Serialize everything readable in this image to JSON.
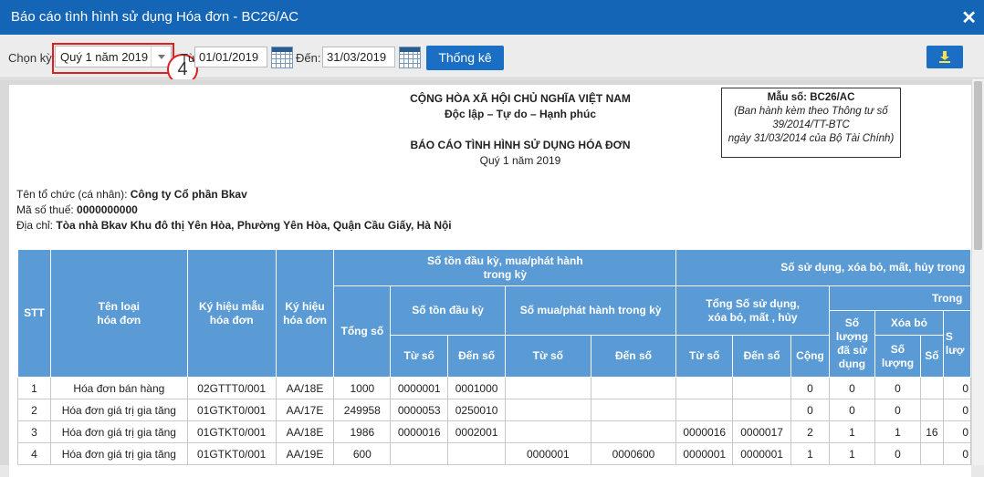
{
  "window": {
    "title": "Báo cáo tình hình sử dụng Hóa đơn - BC26/AC",
    "close_glyph": "✕"
  },
  "toolbar": {
    "period_label": "Chọn kỳ:",
    "period_value": "Quý 1 năm 2019",
    "from_label": "Từ:",
    "from_value": "01/01/2019",
    "to_label": "Đến:",
    "to_value": "31/03/2019",
    "stat_button": "Thống kê",
    "step_badge": "4"
  },
  "report": {
    "nation": "CỘNG HÒA XÃ HỘI CHỦ NGHĨA VIỆT NAM",
    "motto": "Độc lập – Tự do – Hạnh phúc",
    "title": "BÁO CÁO TÌNH HÌNH SỬ DỤNG HÓA ĐƠN",
    "period": "Quý 1 năm 2019",
    "form": {
      "code": "Mẫu số: BC26/AC",
      "line1": "(Ban hành kèm theo Thông tư số",
      "line2": "39/2014/TT-BTC",
      "line3": "ngày 31/03/2014 của Bộ Tài Chính)"
    },
    "org_label": "Tên tổ chức (cá nhân): ",
    "org_value": "Công ty Cổ phần Bkav",
    "tax_label": "Mã số thuế: ",
    "tax_value": "0000000000",
    "addr_label": "Địa chỉ: ",
    "addr_value": "Tòa nhà Bkav Khu đô thị Yên Hòa, Phường Yên Hòa, Quận Cầu Giấy, Hà Nội"
  },
  "table": {
    "h_stt": "STT",
    "h_type": "Tên loại\nhóa đơn",
    "h_template": "Ký hiệu mẫu\nhóa đơn",
    "h_symbol": "Ký hiệu\nhóa đơn",
    "h_opening_group": "Số tồn đầu kỳ, mua/phát hành\ntrong kỳ",
    "h_total": "Tổng số",
    "h_opening": "Số tồn đầu kỳ",
    "h_bought": "Số mua/phát hành trong kỳ",
    "h_from": "Từ số",
    "h_to": "Đến số",
    "h_usage_group": "Số sử dụng, xóa bỏ, mất, hủy trong",
    "h_usage_total": "Tổng Số sử dụng,\nxóa bỏ, mất , hủy",
    "h_sum": "Cộng",
    "h_within": "Trong",
    "h_used_qty": "Số\nlượng\nđã sử\ndụng",
    "h_cancel": "Xóa bỏ",
    "h_qty": "Số\nlượng",
    "h_num": "Số",
    "h_trunc": "S\nlượ",
    "rows": [
      {
        "stt": "1",
        "type": "Hóa đơn bán hàng",
        "template": "02GTTT0/001",
        "symbol": "AA/18E",
        "total": "1000",
        "o_from": "0000001",
        "o_to": "0001000",
        "b_from": "",
        "b_to": "",
        "u_from": "",
        "u_to": "",
        "u_sum": "0",
        "used": "0",
        "c_qty": "0",
        "c_num": "",
        "last": "0"
      },
      {
        "stt": "2",
        "type": "Hóa đơn giá trị gia tăng",
        "template": "01GTKT0/001",
        "symbol": "AA/17E",
        "total": "249958",
        "o_from": "0000053",
        "o_to": "0250010",
        "b_from": "",
        "b_to": "",
        "u_from": "",
        "u_to": "",
        "u_sum": "0",
        "used": "0",
        "c_qty": "0",
        "c_num": "",
        "last": "0"
      },
      {
        "stt": "3",
        "type": "Hóa đơn giá trị gia tăng",
        "template": "01GTKT0/001",
        "symbol": "AA/18E",
        "total": "1986",
        "o_from": "0000016",
        "o_to": "0002001",
        "b_from": "",
        "b_to": "",
        "u_from": "0000016",
        "u_to": "0000017",
        "u_sum": "2",
        "used": "1",
        "c_qty": "1",
        "c_num": "16",
        "last": "0"
      },
      {
        "stt": "4",
        "type": "Hóa đơn giá trị gia tăng",
        "template": "01GTKT0/001",
        "symbol": "AA/19E",
        "total": "600",
        "o_from": "",
        "o_to": "",
        "b_from": "0000001",
        "b_to": "0000600",
        "u_from": "0000001",
        "u_to": "0000001",
        "u_sum": "1",
        "used": "1",
        "c_qty": "0",
        "c_num": "",
        "last": "0"
      }
    ]
  }
}
